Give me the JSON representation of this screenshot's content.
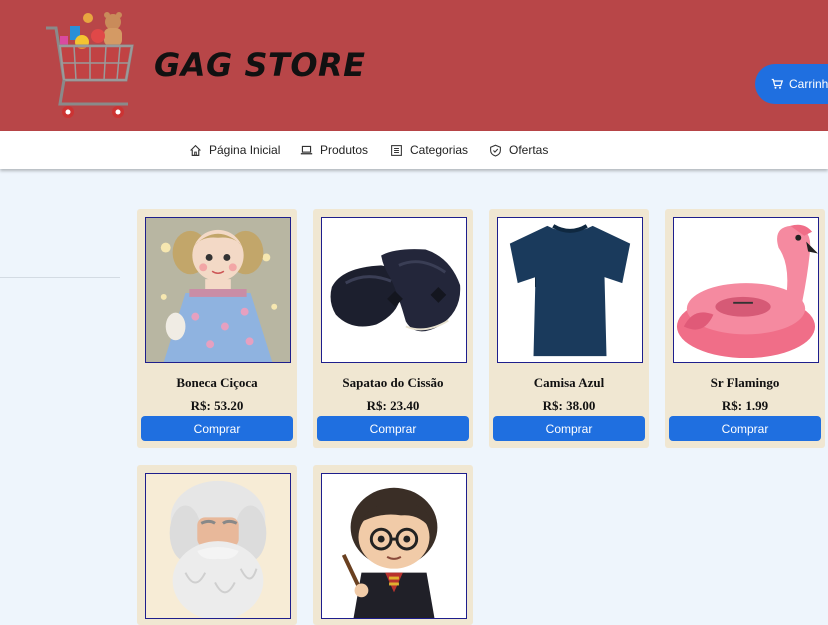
{
  "header": {
    "brand": "GAG STORE",
    "cart_label": "Carrinho",
    "background": "#b84648"
  },
  "nav": {
    "items": [
      {
        "label": "Página Inicial",
        "icon": "home-icon"
      },
      {
        "label": "Produtos",
        "icon": "laptop-icon"
      },
      {
        "label": "Categorias",
        "icon": "list-icon"
      },
      {
        "label": "Ofertas",
        "icon": "shield-check-icon"
      }
    ]
  },
  "products": [
    {
      "name": "Boneca Ciçoca",
      "price": "R$: 53.20",
      "buy_label": "Comprar"
    },
    {
      "name": "Sapatao do Cissão",
      "price": "R$: 23.40",
      "buy_label": "Comprar"
    },
    {
      "name": "Camisa Azul",
      "price": "R$: 38.00",
      "buy_label": "Comprar"
    },
    {
      "name": "Sr Flamingo",
      "price": "R$: 1.99",
      "buy_label": "Comprar"
    },
    {
      "name": "",
      "price": "",
      "buy_label": ""
    },
    {
      "name": "",
      "price": "",
      "buy_label": ""
    }
  ],
  "colors": {
    "accent": "#1f6fe0",
    "card": "#f0e7d2",
    "page": "#eef5fc"
  }
}
